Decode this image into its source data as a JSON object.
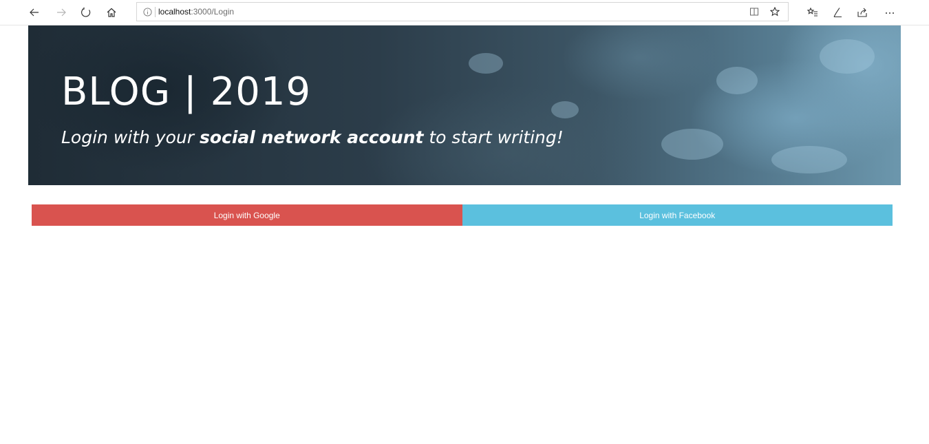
{
  "browser": {
    "address": {
      "host": "localhost",
      "path": ":3000/Login"
    },
    "icons": {
      "back": "back-arrow-icon",
      "forward": "forward-arrow-icon",
      "refresh": "refresh-icon",
      "home": "home-icon",
      "info": "info-icon",
      "reading_view": "reading-view-icon",
      "favorite": "star-icon",
      "favorites_hub": "favorites-list-icon",
      "notes": "pen-icon",
      "share": "share-icon",
      "more": "more-icon"
    }
  },
  "hero": {
    "title": "BLOG | 2019",
    "subtitle_prefix": "Login with your ",
    "subtitle_bold": "social network account",
    "subtitle_suffix": " to start writing!"
  },
  "login": {
    "google_label": "Login with Google",
    "facebook_label": "Login with Facebook",
    "google_color": "#d9534f",
    "facebook_color": "#5bc0de"
  }
}
